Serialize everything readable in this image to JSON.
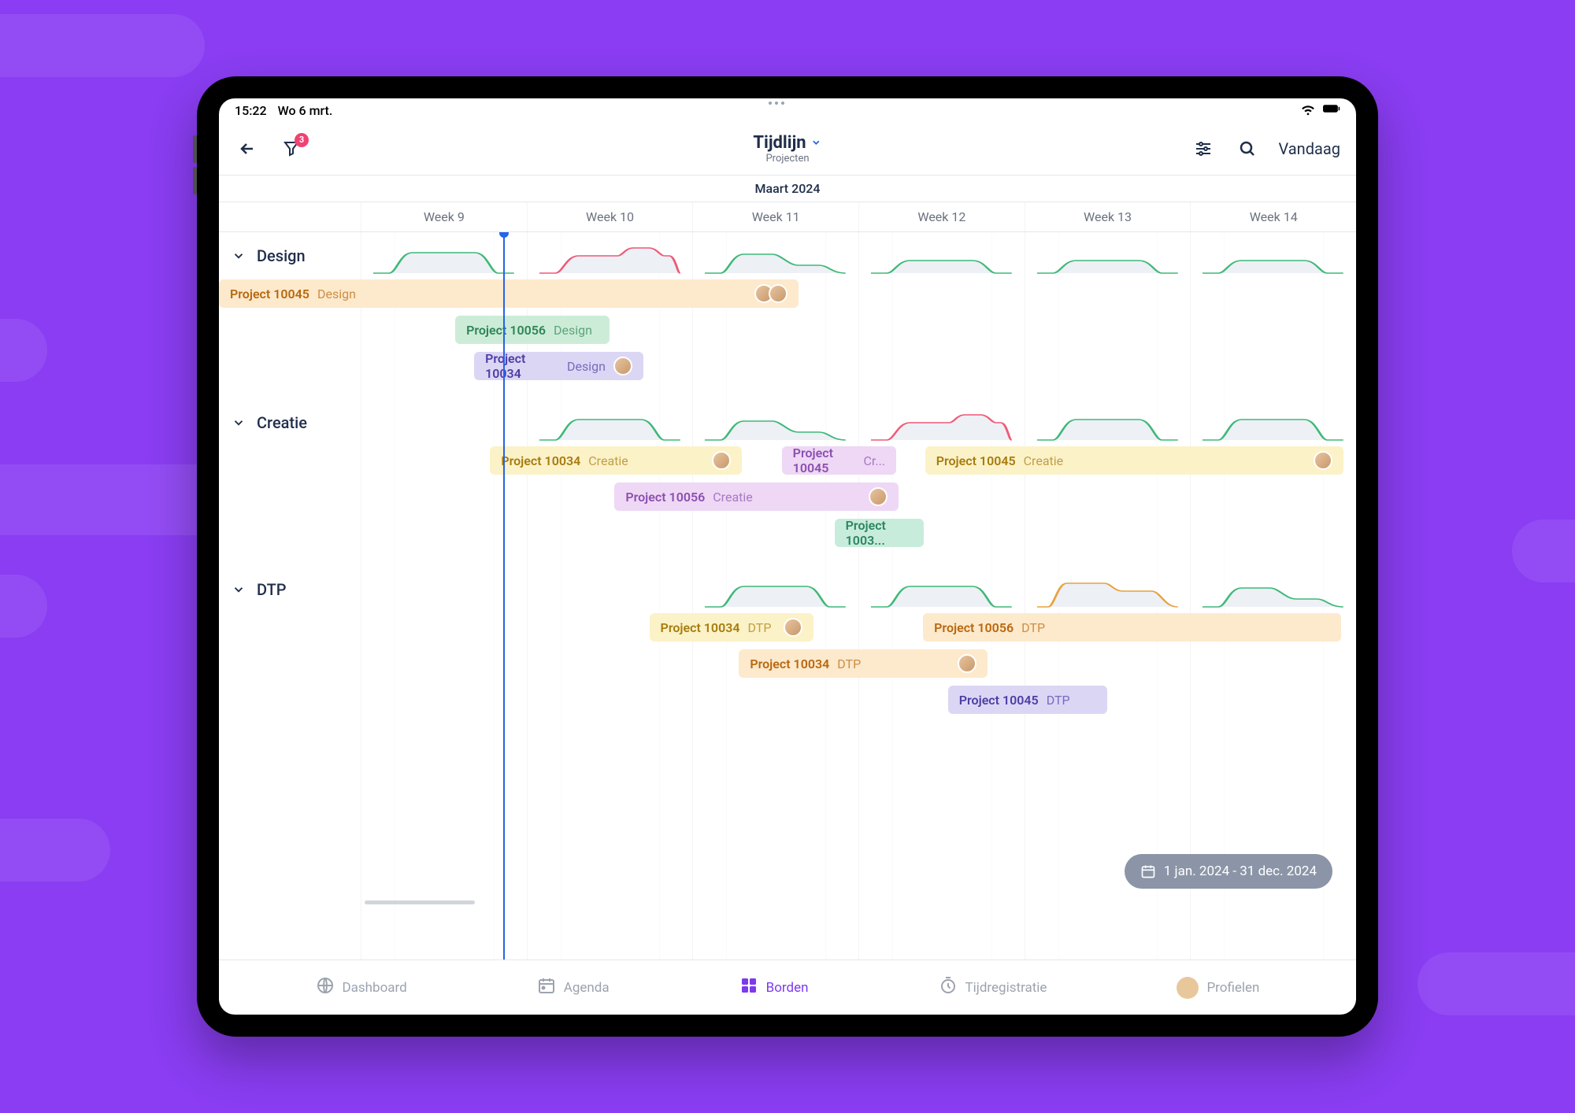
{
  "statusbar": {
    "time": "15:22",
    "date": "Wo 6 mrt."
  },
  "nav": {
    "title": "Tijdlijn",
    "subtitle": "Projecten",
    "badge": "3",
    "today_label": "Vandaag"
  },
  "month_label": "Maart 2024",
  "weeks": [
    "Week 9",
    "Week 10",
    "Week 11",
    "Week 12",
    "Week 13",
    "Week 14"
  ],
  "groups": [
    {
      "name": "Design",
      "bars": [
        {
          "project": "Project 10045",
          "phase": "Design",
          "color": "orange",
          "left_pct": 0,
          "width_pct": 44,
          "row": 0,
          "avatars": 2
        },
        {
          "project": "Project 10056",
          "phase": "Design",
          "color": "green",
          "left_pct": 9.5,
          "width_pct": 15.5,
          "row": 1,
          "avatars": 0
        },
        {
          "project": "Project 10034",
          "phase": "Design",
          "color": "indigo",
          "left_pct": 11.4,
          "width_pct": 17,
          "row": 2,
          "avatars": 1
        }
      ]
    },
    {
      "name": "Creatie",
      "bars": [
        {
          "project": "Project 10034",
          "phase": "Creatie",
          "color": "yellow",
          "left_pct": 13,
          "width_pct": 25.3,
          "row": 0,
          "avatars": 1
        },
        {
          "project": "Project 10045",
          "phase": "Cr...",
          "color": "purple",
          "left_pct": 42.3,
          "width_pct": 11.5,
          "row": 0,
          "avatars": 0
        },
        {
          "project": "Project 10045",
          "phase": "Creatie",
          "color": "yellow",
          "left_pct": 56.7,
          "width_pct": 42,
          "row": 0,
          "avatars": 1
        },
        {
          "project": "Project 10056",
          "phase": "Creatie",
          "color": "purple",
          "left_pct": 25.5,
          "width_pct": 28.5,
          "row": 1,
          "avatars": 1
        },
        {
          "project": "Project 1003...",
          "phase": "",
          "color": "teal",
          "left_pct": 47.6,
          "width_pct": 9,
          "row": 2,
          "avatars": 0
        }
      ]
    },
    {
      "name": "DTP",
      "bars": [
        {
          "project": "Project 10034",
          "phase": "DTP",
          "color": "yellow",
          "left_pct": 29,
          "width_pct": 16.5,
          "row": 0,
          "avatars": 1
        },
        {
          "project": "Project 10056",
          "phase": "DTP",
          "color": "orange",
          "left_pct": 56.5,
          "width_pct": 42,
          "row": 0,
          "avatars": 0
        },
        {
          "project": "Project 10034",
          "phase": "DTP",
          "color": "orange",
          "left_pct": 38,
          "width_pct": 25,
          "row": 1,
          "avatars": 1
        },
        {
          "project": "Project 10045",
          "phase": "DTP",
          "color": "indigo",
          "left_pct": 59,
          "width_pct": 16,
          "row": 2,
          "avatars": 0
        }
      ]
    }
  ],
  "date_range": "1 jan. 2024 - 31 dec. 2024",
  "bottom_nav": [
    {
      "label": "Dashboard",
      "icon": "globe"
    },
    {
      "label": "Agenda",
      "icon": "calendar"
    },
    {
      "label": "Borden",
      "icon": "grid",
      "active": true
    },
    {
      "label": "Tijdregistratie",
      "icon": "timer"
    },
    {
      "label": "Profielen",
      "icon": "profile"
    }
  ]
}
